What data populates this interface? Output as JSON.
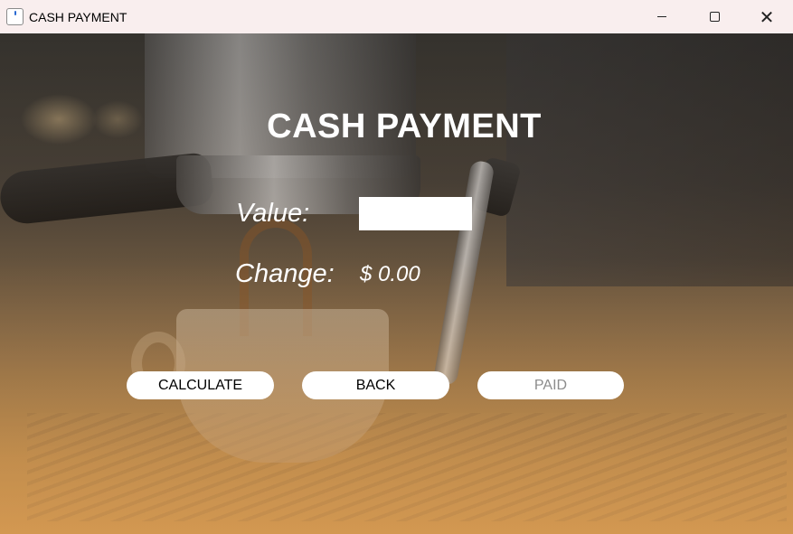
{
  "window": {
    "title": "CASH PAYMENT",
    "icon": "java-coffee-icon",
    "controls": {
      "minimize_icon": "minimize-icon",
      "maximize_icon": "maximize-icon",
      "close_icon": "close-icon",
      "close_glyph": "✕"
    }
  },
  "form": {
    "heading": "CASH PAYMENT",
    "value_label": "Value:",
    "value_input": "",
    "change_label": "Change:",
    "change_amount": "$ 0.00"
  },
  "buttons": {
    "calculate": "CALCULATE",
    "back": "BACK",
    "paid": "PAID"
  },
  "colors": {
    "titlebar": "#f9eeee",
    "text": "#ffffff",
    "disabled_text": "#8c8c8c"
  }
}
